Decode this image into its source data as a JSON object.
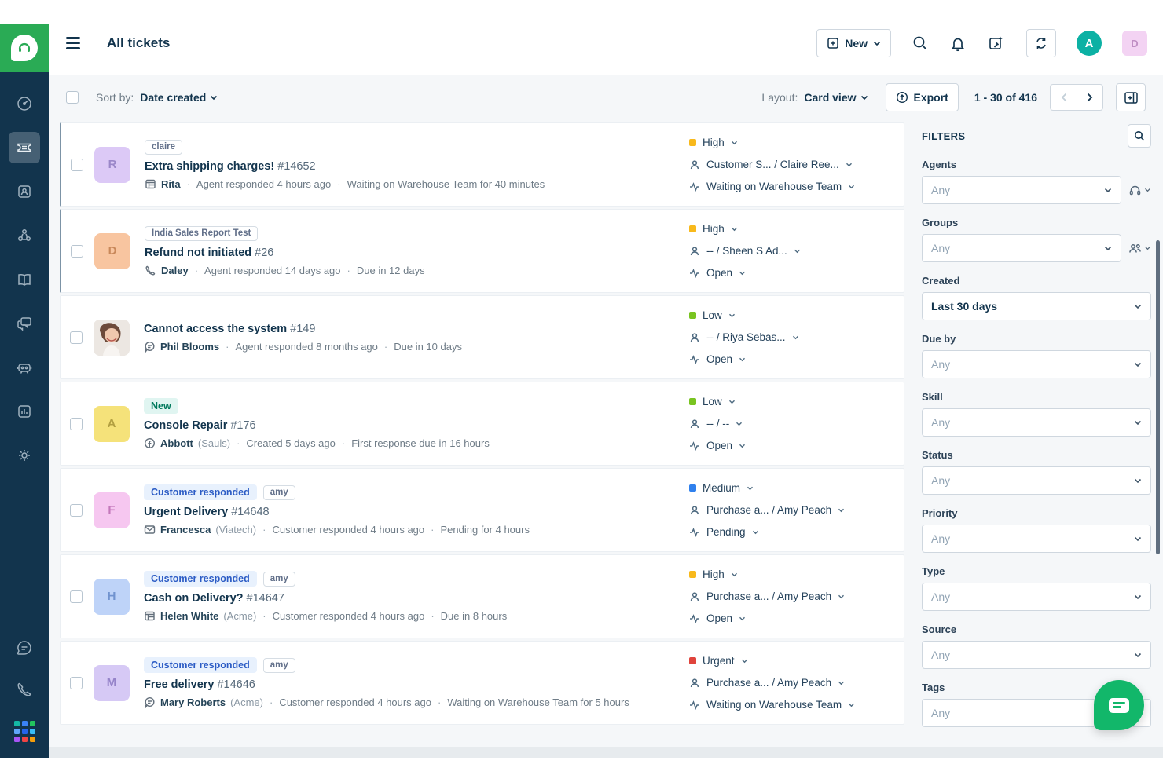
{
  "colors": {
    "brand_green": "#2aab55",
    "sidebar_navy": "#12344d",
    "priority_high": "#f8b91c",
    "priority_medium": "#2f80ed",
    "priority_low": "#79c421",
    "priority_urgent": "#e0443c",
    "badge_blue_bg": "#e8f1fd",
    "badge_blue_text": "#2c5cc5",
    "badge_new_bg": "#e0f5f1",
    "badge_new_text": "#00795c",
    "chat_widget_green": "#12b76a",
    "workspace_avatar_teal": "#0cb1a4"
  },
  "ui": {
    "sep": "·"
  },
  "sidebar": {
    "items": [
      "freshdesk-logo",
      "dashboard",
      "tickets",
      "contacts",
      "customers",
      "solutions",
      "forums",
      "bots",
      "analytics",
      "admin",
      "freshchat",
      "freshcaller",
      "app-switcher"
    ],
    "active_item": "tickets"
  },
  "header": {
    "title": "All tickets",
    "new_button_label": "New",
    "workspace_avatar_letter": "A",
    "user_avatar_letter": "D"
  },
  "toolbar": {
    "sort_label": "Sort by:",
    "sort_value": "Date created",
    "layout_label": "Layout:",
    "layout_value": "Card view",
    "export_label": "Export",
    "pagination": "1 - 30 of 416"
  },
  "tickets": [
    {
      "avatar_initial": "R",
      "tag": "claire",
      "title": "Extra shipping charges!",
      "id": "#14652",
      "source": "portal",
      "contact": "Rita",
      "company": "",
      "meta1": "Agent responded 4 hours ago",
      "meta2": "Waiting on Warehouse Team for 40 minutes",
      "priority": "High",
      "assignee": "Customer S... / Claire Ree...",
      "status": "Waiting on Warehouse Team"
    },
    {
      "avatar_initial": "D",
      "tag": "India Sales Report Test",
      "title": "Refund not initiated",
      "id": "#26",
      "source": "phone",
      "contact": "Daley",
      "company": "",
      "meta1": "Agent responded 14 days ago",
      "meta2": "Due in 12 days",
      "priority": "High",
      "assignee": "-- / Sheen S Ad...",
      "status": "Open"
    },
    {
      "avatar_initial": "",
      "tag": "",
      "title": "Cannot access the system",
      "id": "#149",
      "source": "feedback-widget",
      "contact": "Phil Blooms",
      "company": "",
      "meta1": "Agent responded 8 months ago",
      "meta2": "Due in 10 days",
      "priority": "Low",
      "assignee": "-- / Riya Sebas...",
      "status": "Open"
    },
    {
      "avatar_initial": "A",
      "badge": "New",
      "title": "Console Repair",
      "id": "#176",
      "source": "facebook",
      "contact": "Abbott",
      "company": "(Sauls)",
      "meta1": "Created 5 days ago",
      "meta2": "First response due in 16 hours",
      "priority": "Low",
      "assignee": "-- / --",
      "status": "Open"
    },
    {
      "avatar_initial": "F",
      "badge": "Customer responded",
      "tag": "amy",
      "title": "Urgent Delivery",
      "id": "#14648",
      "source": "email",
      "contact": "Francesca",
      "company": "(Viatech)",
      "meta1": "Customer responded 4 hours ago",
      "meta2": "Pending for 4 hours",
      "priority": "Medium",
      "assignee": "Purchase a... / Amy Peach",
      "status": "Pending"
    },
    {
      "avatar_initial": "H",
      "badge": "Customer responded",
      "tag": "amy",
      "title": "Cash on Delivery?",
      "id": "#14647",
      "source": "portal",
      "contact": "Helen White",
      "company": "(Acme)",
      "meta1": "Customer responded 4 hours ago",
      "meta2": "Due in 8 hours",
      "priority": "High",
      "assignee": "Purchase a... / Amy Peach",
      "status": "Open"
    },
    {
      "avatar_initial": "M",
      "badge": "Customer responded",
      "tag": "amy",
      "title": "Free delivery",
      "id": "#14646",
      "source": "feedback-widget",
      "contact": "Mary Roberts",
      "company": "(Acme)",
      "meta1": "Customer responded 4 hours ago",
      "meta2": "Waiting on Warehouse Team for 5 hours",
      "priority": "Urgent",
      "assignee": "Purchase a... / Amy Peach",
      "status": "Waiting on Warehouse Team"
    }
  ],
  "filters": {
    "title": "FILTERS",
    "fields": [
      {
        "label": "Agents",
        "value": "Any",
        "placeholder": true,
        "side_icon": "headset"
      },
      {
        "label": "Groups",
        "value": "Any",
        "placeholder": true,
        "side_icon": "group"
      },
      {
        "label": "Created",
        "value": "Last 30 days",
        "placeholder": false
      },
      {
        "label": "Due by",
        "value": "Any",
        "placeholder": true
      },
      {
        "label": "Skill",
        "value": "Any",
        "placeholder": true
      },
      {
        "label": "Status",
        "value": "Any",
        "placeholder": true
      },
      {
        "label": "Priority",
        "value": "Any",
        "placeholder": true
      },
      {
        "label": "Type",
        "value": "Any",
        "placeholder": true
      },
      {
        "label": "Source",
        "value": "Any",
        "placeholder": true
      },
      {
        "label": "Tags",
        "value": "Any",
        "placeholder": true
      }
    ]
  }
}
